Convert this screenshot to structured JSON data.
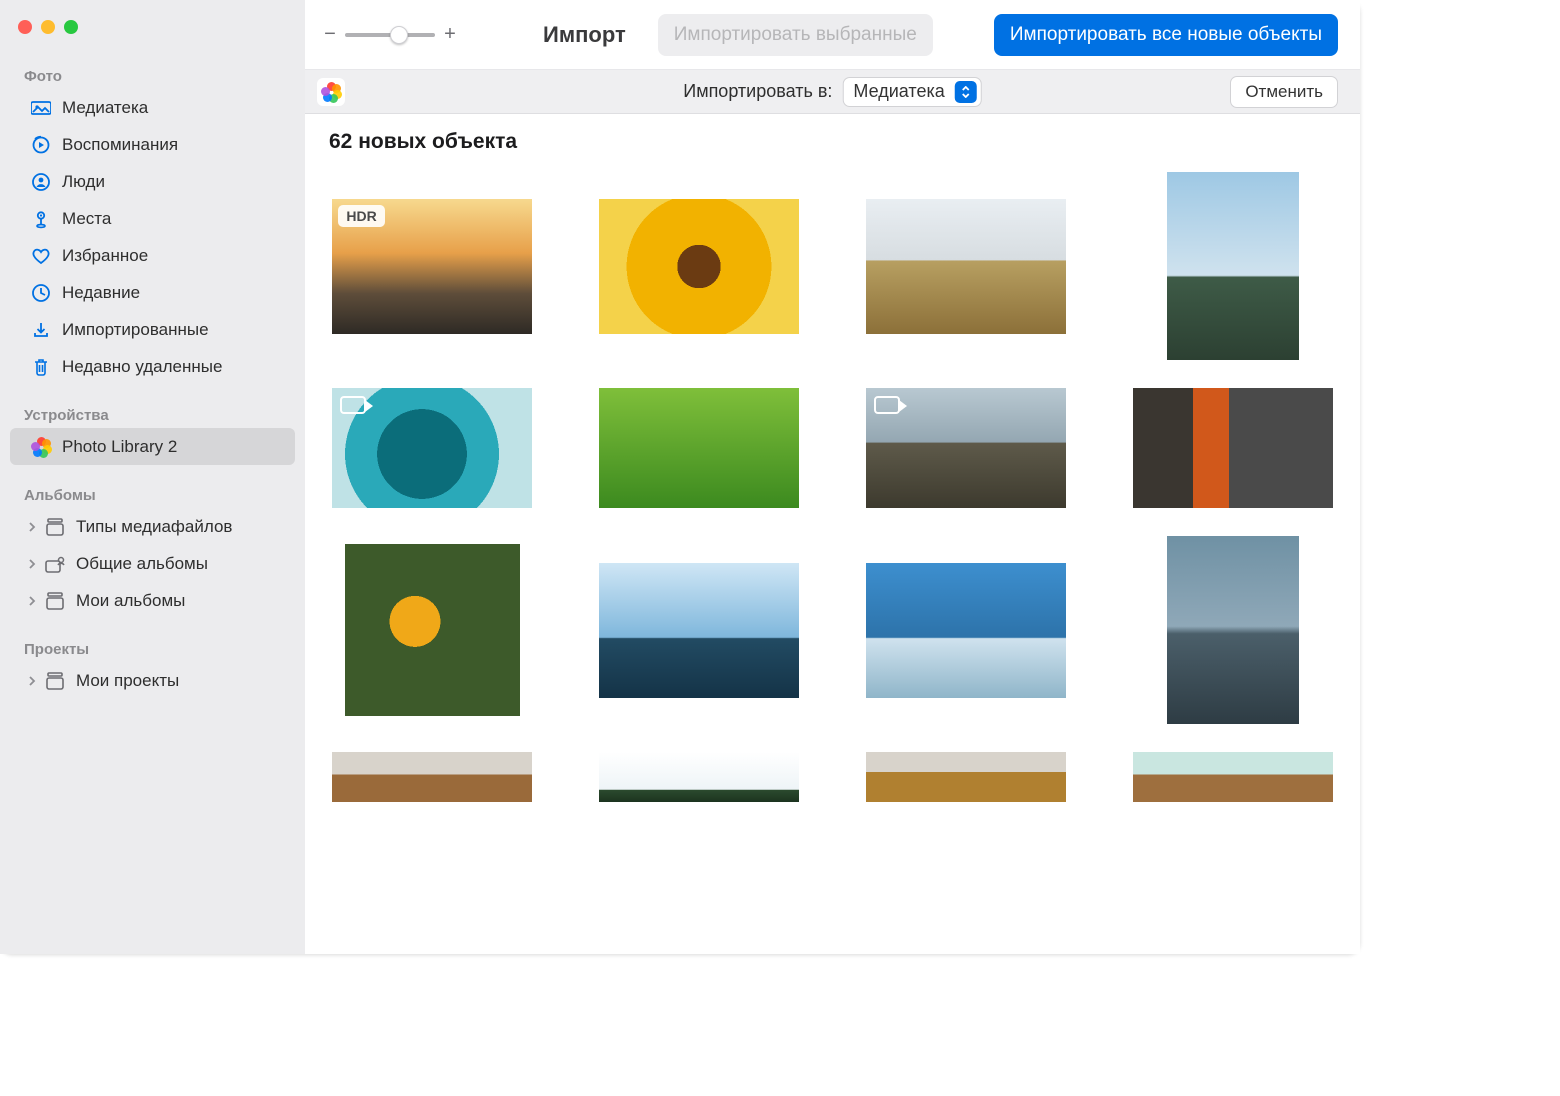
{
  "toolbar": {
    "title": "Импорт",
    "import_selected_label": "Импортировать выбранные",
    "import_all_label": "Импортировать все новые объекты"
  },
  "subbar": {
    "import_to_label": "Импортировать в:",
    "destination": "Медиатека",
    "cancel": "Отменить"
  },
  "content": {
    "heading": "62 новых объекта",
    "hdr_badge": "HDR"
  },
  "sidebar": {
    "sections": {
      "photos": "Фото",
      "devices": "Устройства",
      "albums": "Альбомы",
      "projects": "Проекты"
    },
    "items": {
      "library": "Медиатека",
      "memories": "Воспоминания",
      "people": "Люди",
      "places": "Места",
      "favorites": "Избранное",
      "recent": "Недавние",
      "imports": "Импортированные",
      "trash": "Недавно удаленные",
      "device": "Photo Library 2",
      "media_types": "Типы медиафайлов",
      "shared_albums": "Общие альбомы",
      "my_albums": "Мои альбомы",
      "my_projects": "Мои проекты"
    }
  }
}
